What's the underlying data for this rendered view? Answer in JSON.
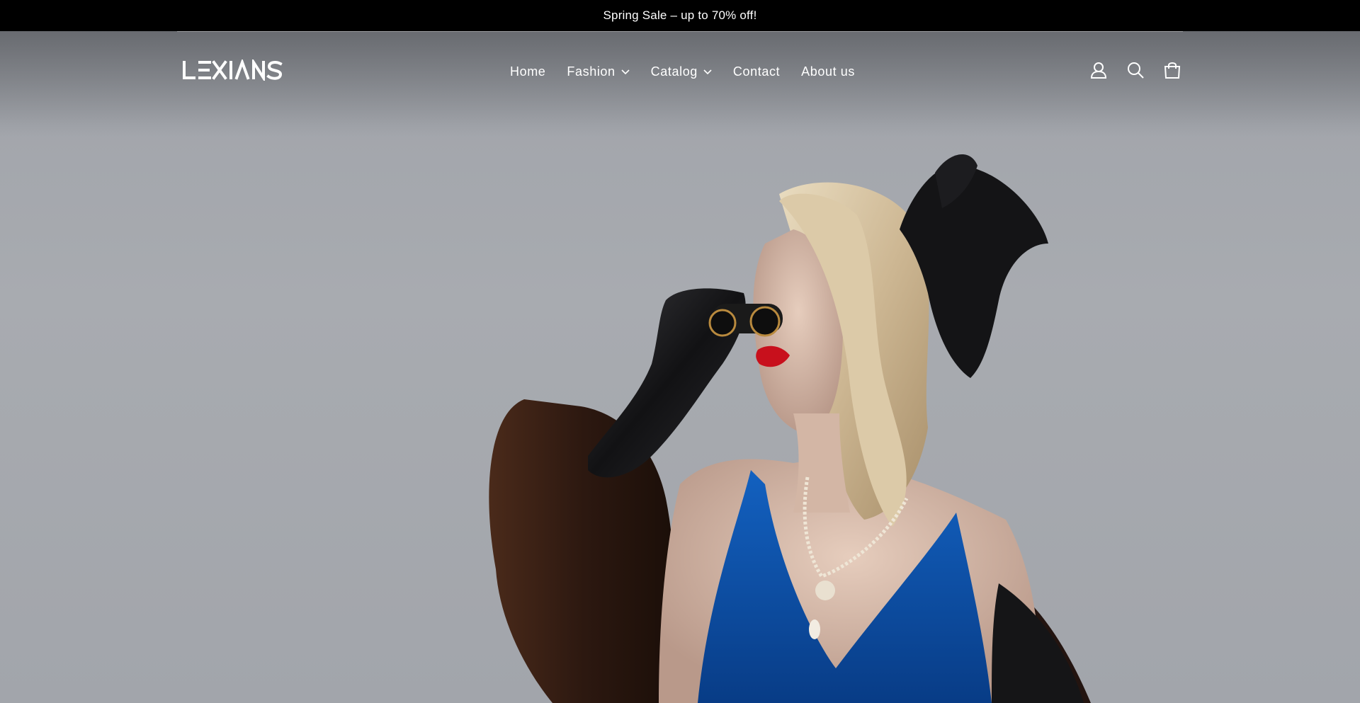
{
  "announcement": {
    "text": "Spring Sale – up to 70% off!"
  },
  "brand": {
    "name": "LEXIANS"
  },
  "nav": {
    "items": [
      {
        "label": "Home",
        "has_dropdown": false
      },
      {
        "label": "Fashion",
        "has_dropdown": true
      },
      {
        "label": "Catalog",
        "has_dropdown": true
      },
      {
        "label": "Contact",
        "has_dropdown": false
      },
      {
        "label": "About us",
        "has_dropdown": false
      }
    ]
  },
  "header_icons": [
    "account-icon",
    "search-icon",
    "cart-icon"
  ],
  "colors": {
    "announcement_bg": "#000000",
    "text_on_dark": "#ffffff",
    "hero_bg": "#a4a7ad",
    "dress_blue": "#0c4ea0",
    "lips_red": "#c8101c"
  }
}
